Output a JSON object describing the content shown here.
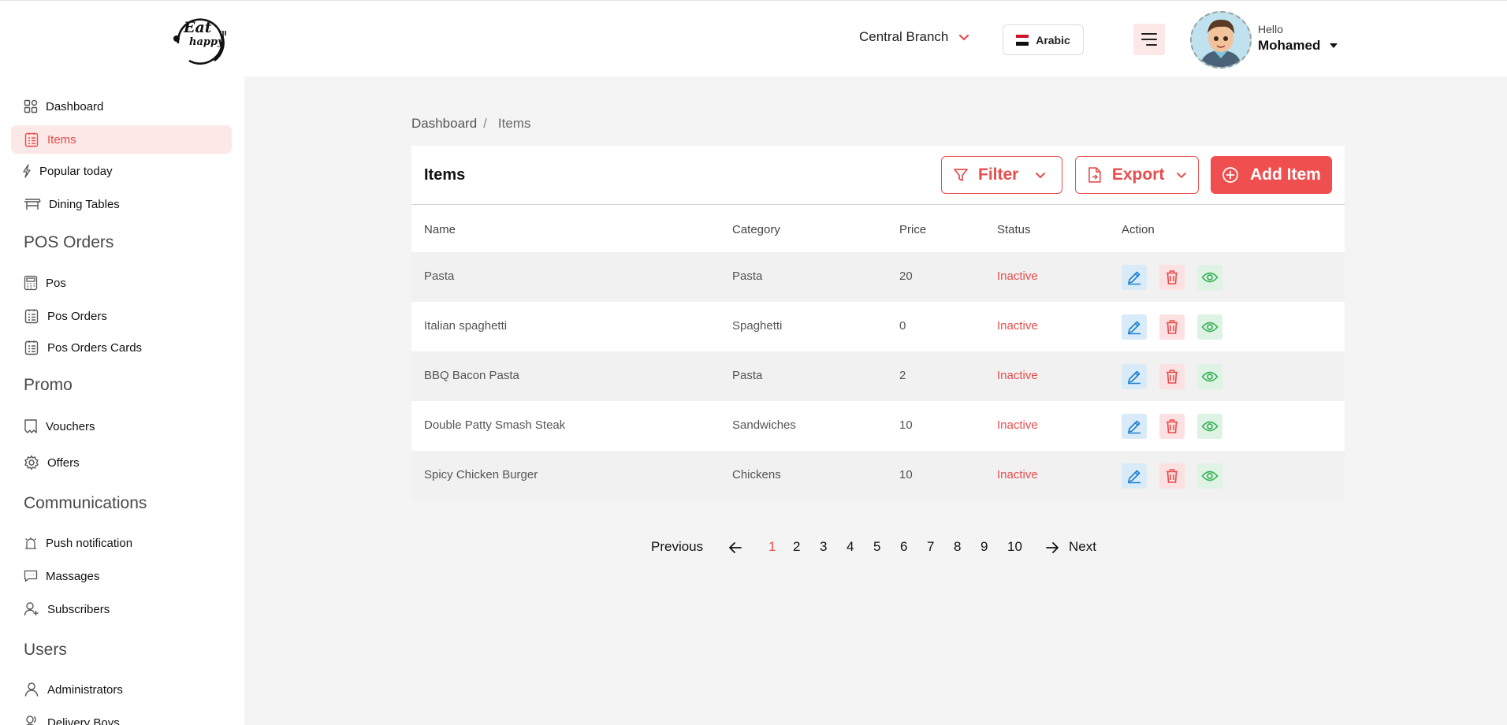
{
  "header": {
    "branch": "Central Branch",
    "language": "Arabic",
    "greeting": "Hello",
    "user_name": "Mohamed"
  },
  "logo": {
    "line1": "Eat",
    "line2": "happy"
  },
  "sidebar": {
    "items_top": [
      {
        "label": "Dashboard",
        "icon": "dashboard-icon"
      },
      {
        "label": "Items",
        "icon": "clipboard-list-icon",
        "active": true
      },
      {
        "label": "Popular today",
        "icon": "bolt-icon"
      },
      {
        "label": "Dining Tables",
        "icon": "table-icon"
      }
    ],
    "sections": [
      {
        "title": "POS Orders",
        "items": [
          {
            "label": "Pos",
            "icon": "calculator-icon"
          },
          {
            "label": "Pos Orders",
            "icon": "clipboard-list-icon"
          },
          {
            "label": "Pos Orders Cards",
            "icon": "clipboard-list-icon"
          }
        ]
      },
      {
        "title": "Promo",
        "items": [
          {
            "label": "Vouchers",
            "icon": "voucher-icon"
          },
          {
            "label": "Offers",
            "icon": "gear-icon"
          }
        ]
      },
      {
        "title": "Communications",
        "items": [
          {
            "label": "Push notification",
            "icon": "alarm-icon"
          },
          {
            "label": "Massages",
            "icon": "message-icon"
          },
          {
            "label": "Subscribers",
            "icon": "user-plus-icon"
          }
        ]
      },
      {
        "title": "Users",
        "items": [
          {
            "label": "Administrators",
            "icon": "user-icon"
          },
          {
            "label": "Delivery Boys",
            "icon": "users-icon"
          }
        ]
      }
    ]
  },
  "breadcrumb": {
    "home": "Dashboard",
    "separator": "/",
    "current": "Items"
  },
  "card": {
    "title": "Items",
    "filter_label": "Filter",
    "export_label": "Export",
    "add_label": "Add Item"
  },
  "table": {
    "columns": [
      "Name",
      "Category",
      "Price",
      "Status",
      "Action"
    ],
    "rows": [
      {
        "name": "Pasta",
        "category": "Pasta",
        "price": "20",
        "status": "Inactive"
      },
      {
        "name": "Italian spaghetti",
        "category": "Spaghetti",
        "price": "0",
        "status": "Inactive"
      },
      {
        "name": "BBQ Bacon Pasta",
        "category": "Pasta",
        "price": "2",
        "status": "Inactive"
      },
      {
        "name": "Double Patty Smash Steak",
        "category": "Sandwiches",
        "price": "10",
        "status": "Inactive"
      },
      {
        "name": "Spicy Chicken Burger",
        "category": "Chickens",
        "price": "10",
        "status": "Inactive"
      }
    ]
  },
  "pagination": {
    "previous": "Previous",
    "next": "Next",
    "pages": [
      "1",
      "2",
      "3",
      "4",
      "5",
      "6",
      "7",
      "8",
      "9",
      "10"
    ],
    "current": "1"
  },
  "colors": {
    "accent": "#e84c4c",
    "edit": "#1e7fd1",
    "view": "#3bb25a"
  }
}
